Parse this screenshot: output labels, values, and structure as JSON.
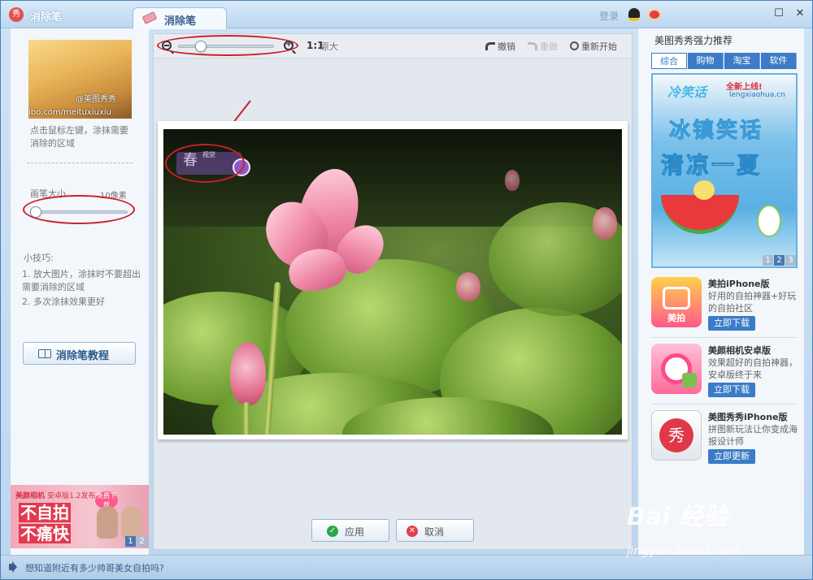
{
  "window": {
    "app_name": "消除笔",
    "tab_label": "消除笔",
    "login": "登录",
    "logo_text": "秀"
  },
  "left": {
    "thumbnail_watermark": "ibo.com/meituxiuxiu",
    "thumbnail_handle": "@美图秀秀",
    "hint": "点击鼠标左键，涂抹需要消除的区域",
    "brush_size_label": "画笔大小",
    "brush_size_value": "10像素",
    "brush_size_percent": 0,
    "tips_title": "小技巧:",
    "tips": [
      "1. 放大图片，涂抹时不要超出需要消除的区域",
      "2. 多次涂抹效果更好"
    ],
    "tutorial_button": "消除笔教程",
    "ad": {
      "brand": "美颜相机",
      "version": "安卓版1.2发布",
      "line1": "不自拍",
      "line2": "不痛快",
      "badge": "免费下载",
      "pager": [
        "1",
        "2"
      ]
    }
  },
  "toolbar": {
    "one_to_one": "1:1",
    "original_size": "原大",
    "undo": "撤销",
    "redo": "重做",
    "restart": "重新开始",
    "zoom_percent": 20
  },
  "canvas": {
    "watermark": "春",
    "watermark_small": "视觉"
  },
  "actions": {
    "apply": "应用",
    "cancel": "取消"
  },
  "right": {
    "title": "美图秀秀强力推荐",
    "tabs": [
      "综合",
      "购物",
      "淘宝",
      "软件"
    ],
    "banner": {
      "brand": "冷笑话",
      "new_online": "全新上线!",
      "url": "lengxiaohua.cn",
      "line1": "冰镇笑话",
      "line2": "清凉一夏",
      "pager": [
        "1",
        "2",
        "3"
      ]
    },
    "apps": [
      {
        "name": "美拍iPhone版",
        "desc": "好用的自拍神器+好玩的自拍社区",
        "button": "立即下载",
        "icon_text": "美拍"
      },
      {
        "name": "美颜相机安卓版",
        "desc": "效果超好的自拍神器，安卓版终于来",
        "button": "立即下载",
        "icon_text": ""
      },
      {
        "name": "美图秀秀iPhone版",
        "desc": "拼图新玩法让你变成海报设计师",
        "button": "立即更新",
        "icon_text": "秀"
      }
    ]
  },
  "status": {
    "text": "想知道附近有多少帅哥美女自拍吗?"
  },
  "watermark": {
    "site": "Bai 经验",
    "url": "jingyan.baidu.com"
  },
  "colors": {
    "accent": "#3b7bc7",
    "annotation": "#c8202a"
  }
}
